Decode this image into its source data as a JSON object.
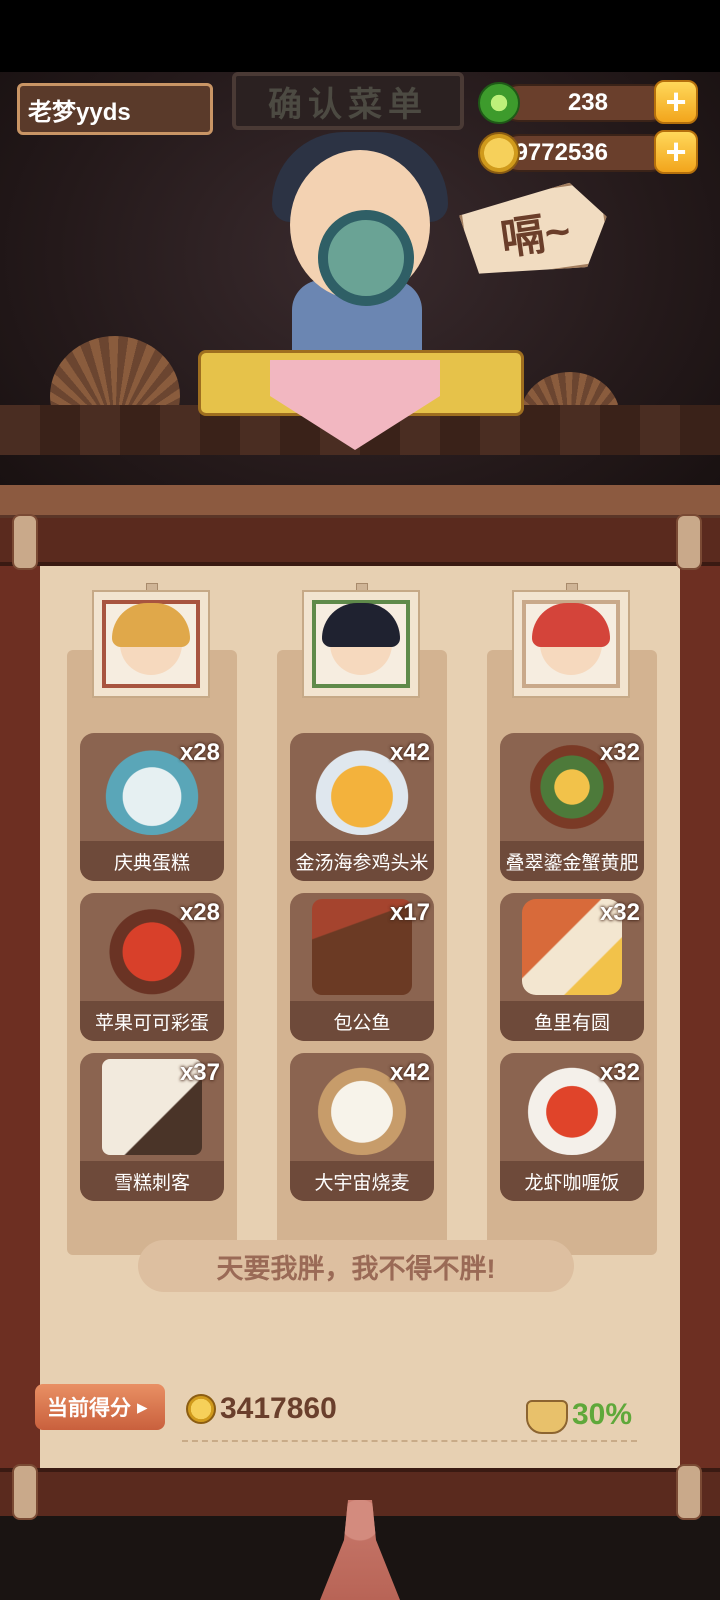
{
  "header": {
    "sign_title": "确认菜单",
    "player_name": "老梦yyds",
    "jade": {
      "icon": "jade-coin-icon",
      "value": "238",
      "plus": "+"
    },
    "gold": {
      "icon": "gold-coin-icon",
      "value": "9772536",
      "plus": "+"
    }
  },
  "scene": {
    "speech": "嗝~"
  },
  "columns": [
    {
      "portrait": "blonde-hero-portrait",
      "dishes": [
        {
          "name": "庆典蛋糕",
          "count": "x28"
        },
        {
          "name": "苹果可可彩蛋",
          "count": "x28"
        },
        {
          "name": "雪糕刺客",
          "count": "x37"
        }
      ]
    },
    {
      "portrait": "black-hair-hero-portrait",
      "dishes": [
        {
          "name": "金汤海参鸡头米",
          "count": "x42"
        },
        {
          "name": "包公鱼",
          "count": "x17"
        },
        {
          "name": "大宇宙烧麦",
          "count": "x42"
        }
      ]
    },
    {
      "portrait": "red-hair-heroine-portrait",
      "dishes": [
        {
          "name": "叠翠鎏金蟹黄肥",
          "count": "x32"
        },
        {
          "name": "鱼里有圆",
          "count": "x32"
        },
        {
          "name": "龙虾咖喱饭",
          "count": "x32"
        }
      ]
    }
  ],
  "slogan": "天要我胖，我不得不胖!",
  "score": {
    "button_label": "当前得分",
    "value": "3417860",
    "bonus_percent": "30%"
  },
  "colors": {
    "wood": "#5a2a1e",
    "paper": "#e7d0b2",
    "dish_bg": "#8b6450",
    "gold": "#f2a51c",
    "bonus_green": "#5fa83a"
  }
}
